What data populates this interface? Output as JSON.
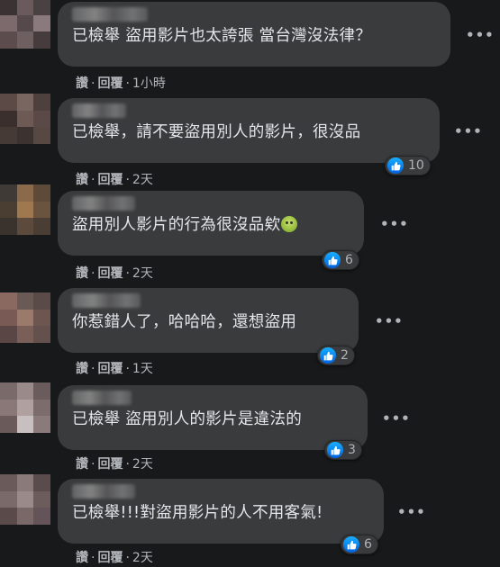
{
  "labels": {
    "like": "讚",
    "reply": "回覆",
    "more": "•••"
  },
  "comments": [
    {
      "text": "已檢舉 盜用影片也太誇張 當台灣沒法律？",
      "time": "1小時",
      "reactions": ""
    },
    {
      "text": "已檢舉，請不要盜用別人的影片，很沒品",
      "time": "2天",
      "reactions": "10"
    },
    {
      "text": "盜用別人影片的行為很沒品欸",
      "time": "2天",
      "reactions": "6",
      "emoji": "sick-face-emoji"
    },
    {
      "text": "你惹錯人了，哈哈哈，還想盜用",
      "time": "1天",
      "reactions": "2"
    },
    {
      "text": "已檢舉 盜用別人的影片是違法的",
      "time": "2天",
      "reactions": "3"
    },
    {
      "text": "已檢舉!!!對盜用影片的人不用客氣!",
      "time": "2天",
      "reactions": "6"
    }
  ],
  "colors": {
    "background": "#18191a",
    "bubble": "#3a3b3c",
    "text": "#e4e6eb",
    "meta": "#b0b3b8",
    "like": "#1877f2"
  },
  "icons": [
    "like-thumb-icon",
    "more-options-icon"
  ]
}
